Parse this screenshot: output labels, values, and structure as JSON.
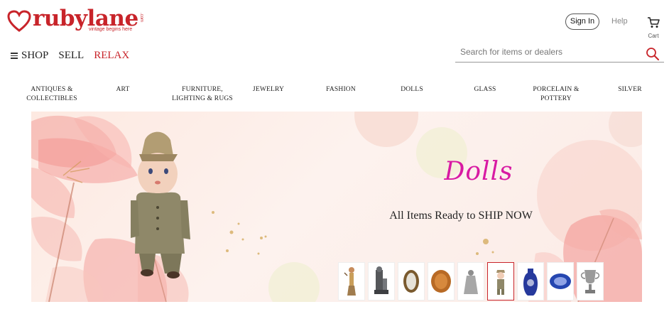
{
  "header": {
    "logo_text": "rubylane",
    "logo_domain": ".com",
    "logo_tagline": "vintage begins here",
    "sign_in_label": "Sign In",
    "help_label": "Help",
    "cart_label": "Cart",
    "cart_icon": "cart-icon"
  },
  "nav": {
    "shop_label": "SHOP",
    "sell_label": "SELL",
    "relax_label": "RELAX",
    "menu_icon": "hamburger-icon"
  },
  "search": {
    "placeholder": "Search for items or dealers",
    "value": "",
    "icon": "search-icon"
  },
  "categories": [
    {
      "line1": "ANTIQUES &",
      "line2": "COLLECTIBLES"
    },
    {
      "line1": "ART",
      "line2": ""
    },
    {
      "line1": "FURNITURE,",
      "line2": "LIGHTING & RUGS"
    },
    {
      "line1": "JEWELRY",
      "line2": ""
    },
    {
      "line1": "FASHION",
      "line2": ""
    },
    {
      "line1": "DOLLS",
      "line2": ""
    },
    {
      "line1": "GLASS",
      "line2": ""
    },
    {
      "line1": "PORCELAIN &",
      "line2": "POTTERY"
    },
    {
      "line1": "SILVER",
      "line2": ""
    }
  ],
  "banner": {
    "title": "Dolls",
    "subtitle": "All Items Ready to SHIP NOW",
    "active_thumbnail": 5,
    "thumbnails": [
      "figurine-thumbnail",
      "cast-iron-statue-thumbnail",
      "mirror-thumbnail",
      "amber-plate-thumbnail",
      "silver-bell-figure-thumbnail",
      "doll-thumbnail",
      "blue-vase-thumbnail",
      "blue-platter-thumbnail",
      "silver-trophy-thumbnail"
    ]
  },
  "colors": {
    "brand_red": "#c8242a",
    "title_magenta": "#d81aa3",
    "banner_background": "#fdeee9"
  }
}
